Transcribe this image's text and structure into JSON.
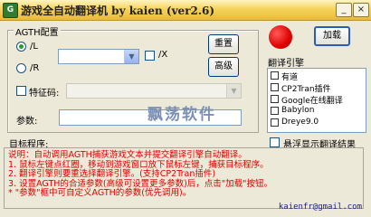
{
  "window": {
    "title": "游戏全自动翻译机  by kaien (ver2.6)",
    "icon_char": "G",
    "minimize_glyph": "_",
    "close_glyph": "×"
  },
  "agth_group": {
    "legend": "AGTH配置",
    "radio_l_label": "/L",
    "radio_l_checked": true,
    "radio_r_label": "/R",
    "checkbox_x_label": "/X",
    "feature_code_label": "特征码:",
    "params_label": "参数:",
    "params_value": ""
  },
  "buttons": {
    "reset": "重置",
    "advanced": "高级",
    "load": "加载"
  },
  "engine_group": {
    "legend": "翻译引擎",
    "items": [
      {
        "label": "有道",
        "checked": false
      },
      {
        "label": "CP2Tran插件",
        "checked": false
      },
      {
        "label": "Google在线翻译",
        "checked": false
      },
      {
        "label": "Babylon",
        "checked": false
      },
      {
        "label": "Dreye9.0",
        "checked": false
      }
    ]
  },
  "target_program_label": "目标程序:",
  "watermark_text": "飘荡软件",
  "hover_option_label": "悬浮显示翻译结果",
  "instructions": [
    "说明：自动调用AGTH捕获游戏文本并提交翻译引擎自动翻译。",
    "  1. 鼠标左键点红圈，移动到游戏窗口放下鼠标左键，捕获目标程序。",
    "  2. 翻译引擎则要重选择翻译引擎。(支持CP2Tran插件)",
    "  3. 设置AGTH的合适参数(高级可设置更多参数)后，点击\"加载\"按钮。",
    "  * \"参数\"框中可自定义AGTH的参数(优先调用)。"
  ],
  "email": "kaienfr@gmail.com",
  "colors": {
    "instruction_text": "#E00000",
    "led_red": "#E00000",
    "titlebar": "#F6D45A"
  }
}
